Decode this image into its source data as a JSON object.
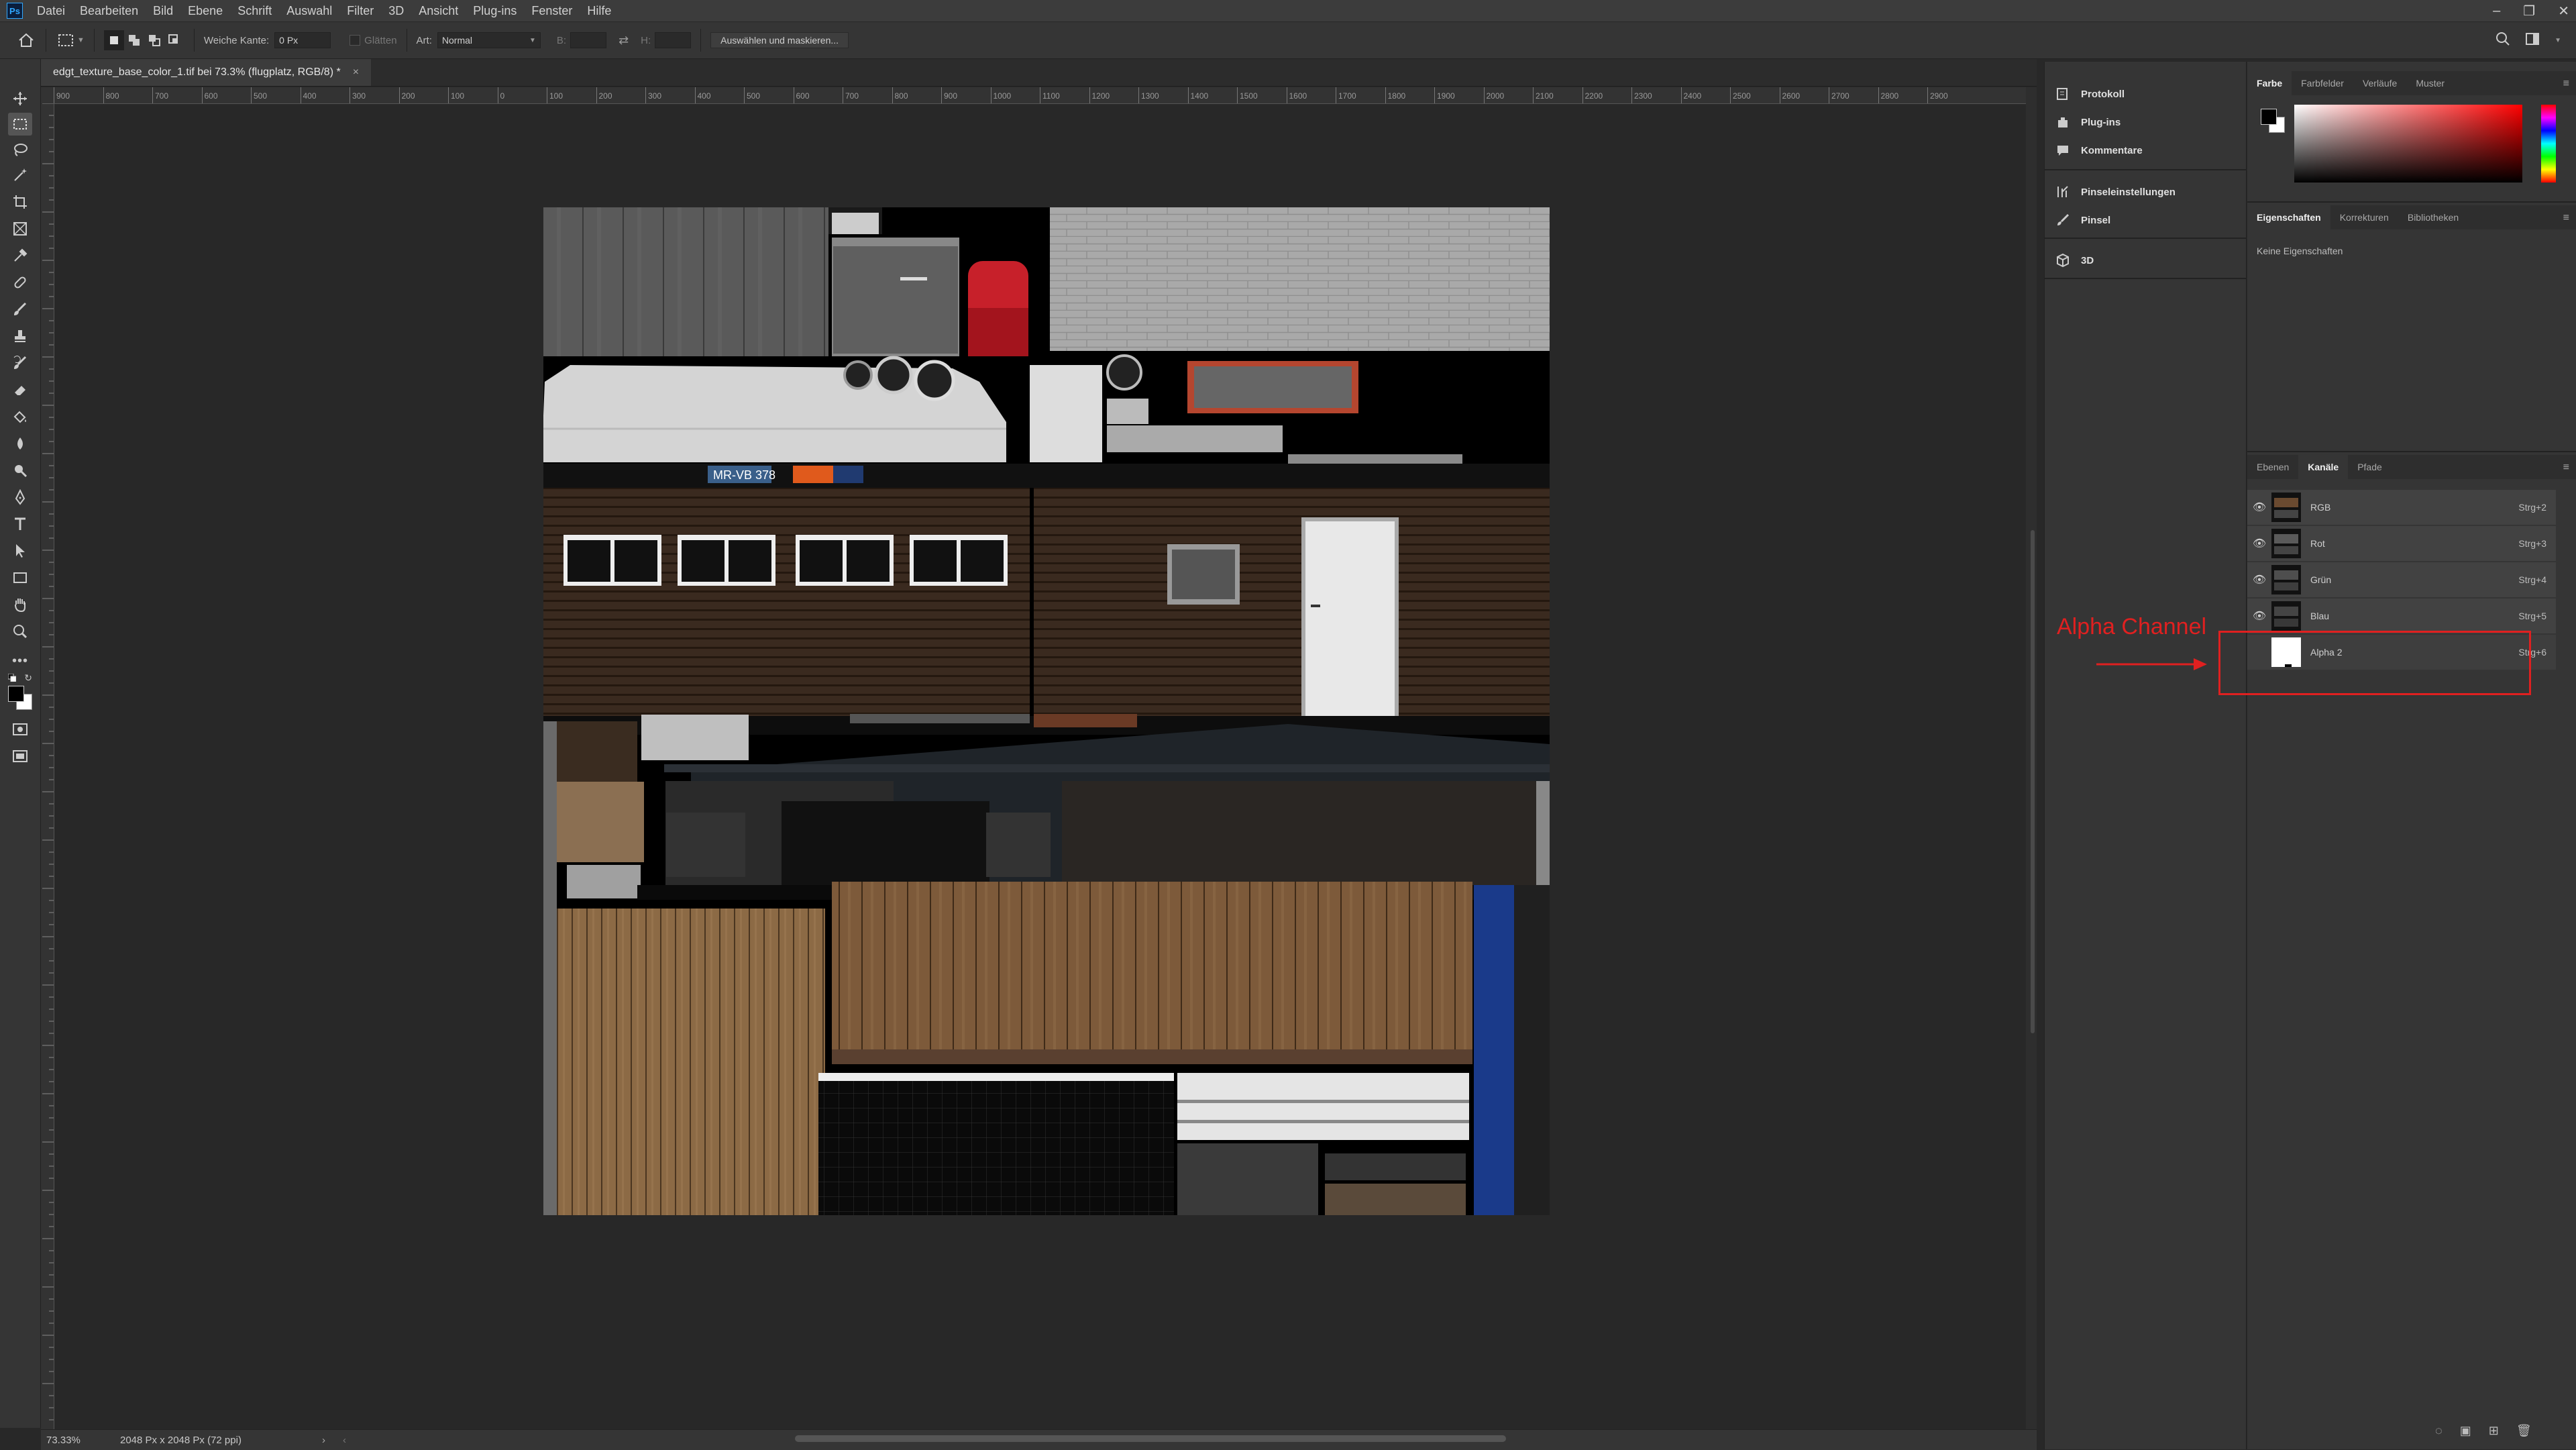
{
  "menubar": {
    "items": [
      "Datei",
      "Bearbeiten",
      "Bild",
      "Ebene",
      "Schrift",
      "Auswahl",
      "Filter",
      "3D",
      "Ansicht",
      "Plug-ins",
      "Fenster",
      "Hilfe"
    ]
  },
  "options": {
    "soft_edge_label": "Weiche Kante:",
    "soft_edge_value": "0 Px",
    "antialias_label": "Glätten",
    "style_label": "Art:",
    "style_value": "Normal",
    "width_label": "B:",
    "height_label": "H:",
    "select_mask_label": "Auswählen und maskieren..."
  },
  "document": {
    "tab_title": "edgt_texture_base_color_1.tif bei 73.3% (flugplatz, RGB/8) *",
    "close": "×"
  },
  "ruler": {
    "ticks": [
      "900",
      "800",
      "700",
      "600",
      "500",
      "400",
      "300",
      "200",
      "100",
      "0",
      "100",
      "200",
      "300",
      "400",
      "500",
      "600",
      "700",
      "800",
      "900",
      "1000",
      "1100",
      "1200",
      "1300",
      "1400",
      "1500",
      "1600",
      "1700",
      "1800",
      "1900",
      "2000",
      "2100",
      "2200",
      "2300",
      "2400",
      "2500",
      "2600",
      "2700",
      "2800",
      "2900"
    ]
  },
  "texture": {
    "license_plate": "MR-VB 378"
  },
  "status": {
    "zoom": "73.33%",
    "doc_size": "2048 Px x 2048 Px (72 ppi)"
  },
  "collapsed_panel": {
    "items": [
      "Protokoll",
      "Plug-ins",
      "Kommentare",
      "Pinseleinstellungen",
      "Pinsel",
      "3D"
    ]
  },
  "color_panel": {
    "tabs": [
      "Farbe",
      "Farbfelder",
      "Verläufe",
      "Muster"
    ],
    "foreground": "#000000",
    "background": "#ffffff"
  },
  "properties_panel": {
    "tabs": [
      "Eigenschaften",
      "Korrekturen",
      "Bibliotheken"
    ],
    "empty_text": "Keine Eigenschaften"
  },
  "channels_panel": {
    "tabs": [
      "Ebenen",
      "Kanäle",
      "Pfade"
    ],
    "channels": [
      {
        "name": "RGB",
        "shortcut": "Strg+2"
      },
      {
        "name": "Rot",
        "shortcut": "Strg+3"
      },
      {
        "name": "Grün",
        "shortcut": "Strg+4"
      },
      {
        "name": "Blau",
        "shortcut": "Strg+5"
      },
      {
        "name": "Alpha 2",
        "shortcut": "Strg+6"
      }
    ]
  },
  "annotation": {
    "label": "Alpha Channel",
    "color": "#e02020"
  },
  "colors": {
    "app_bg": "#282828",
    "panel_bg": "#353535",
    "accent": "#31a8ff"
  }
}
